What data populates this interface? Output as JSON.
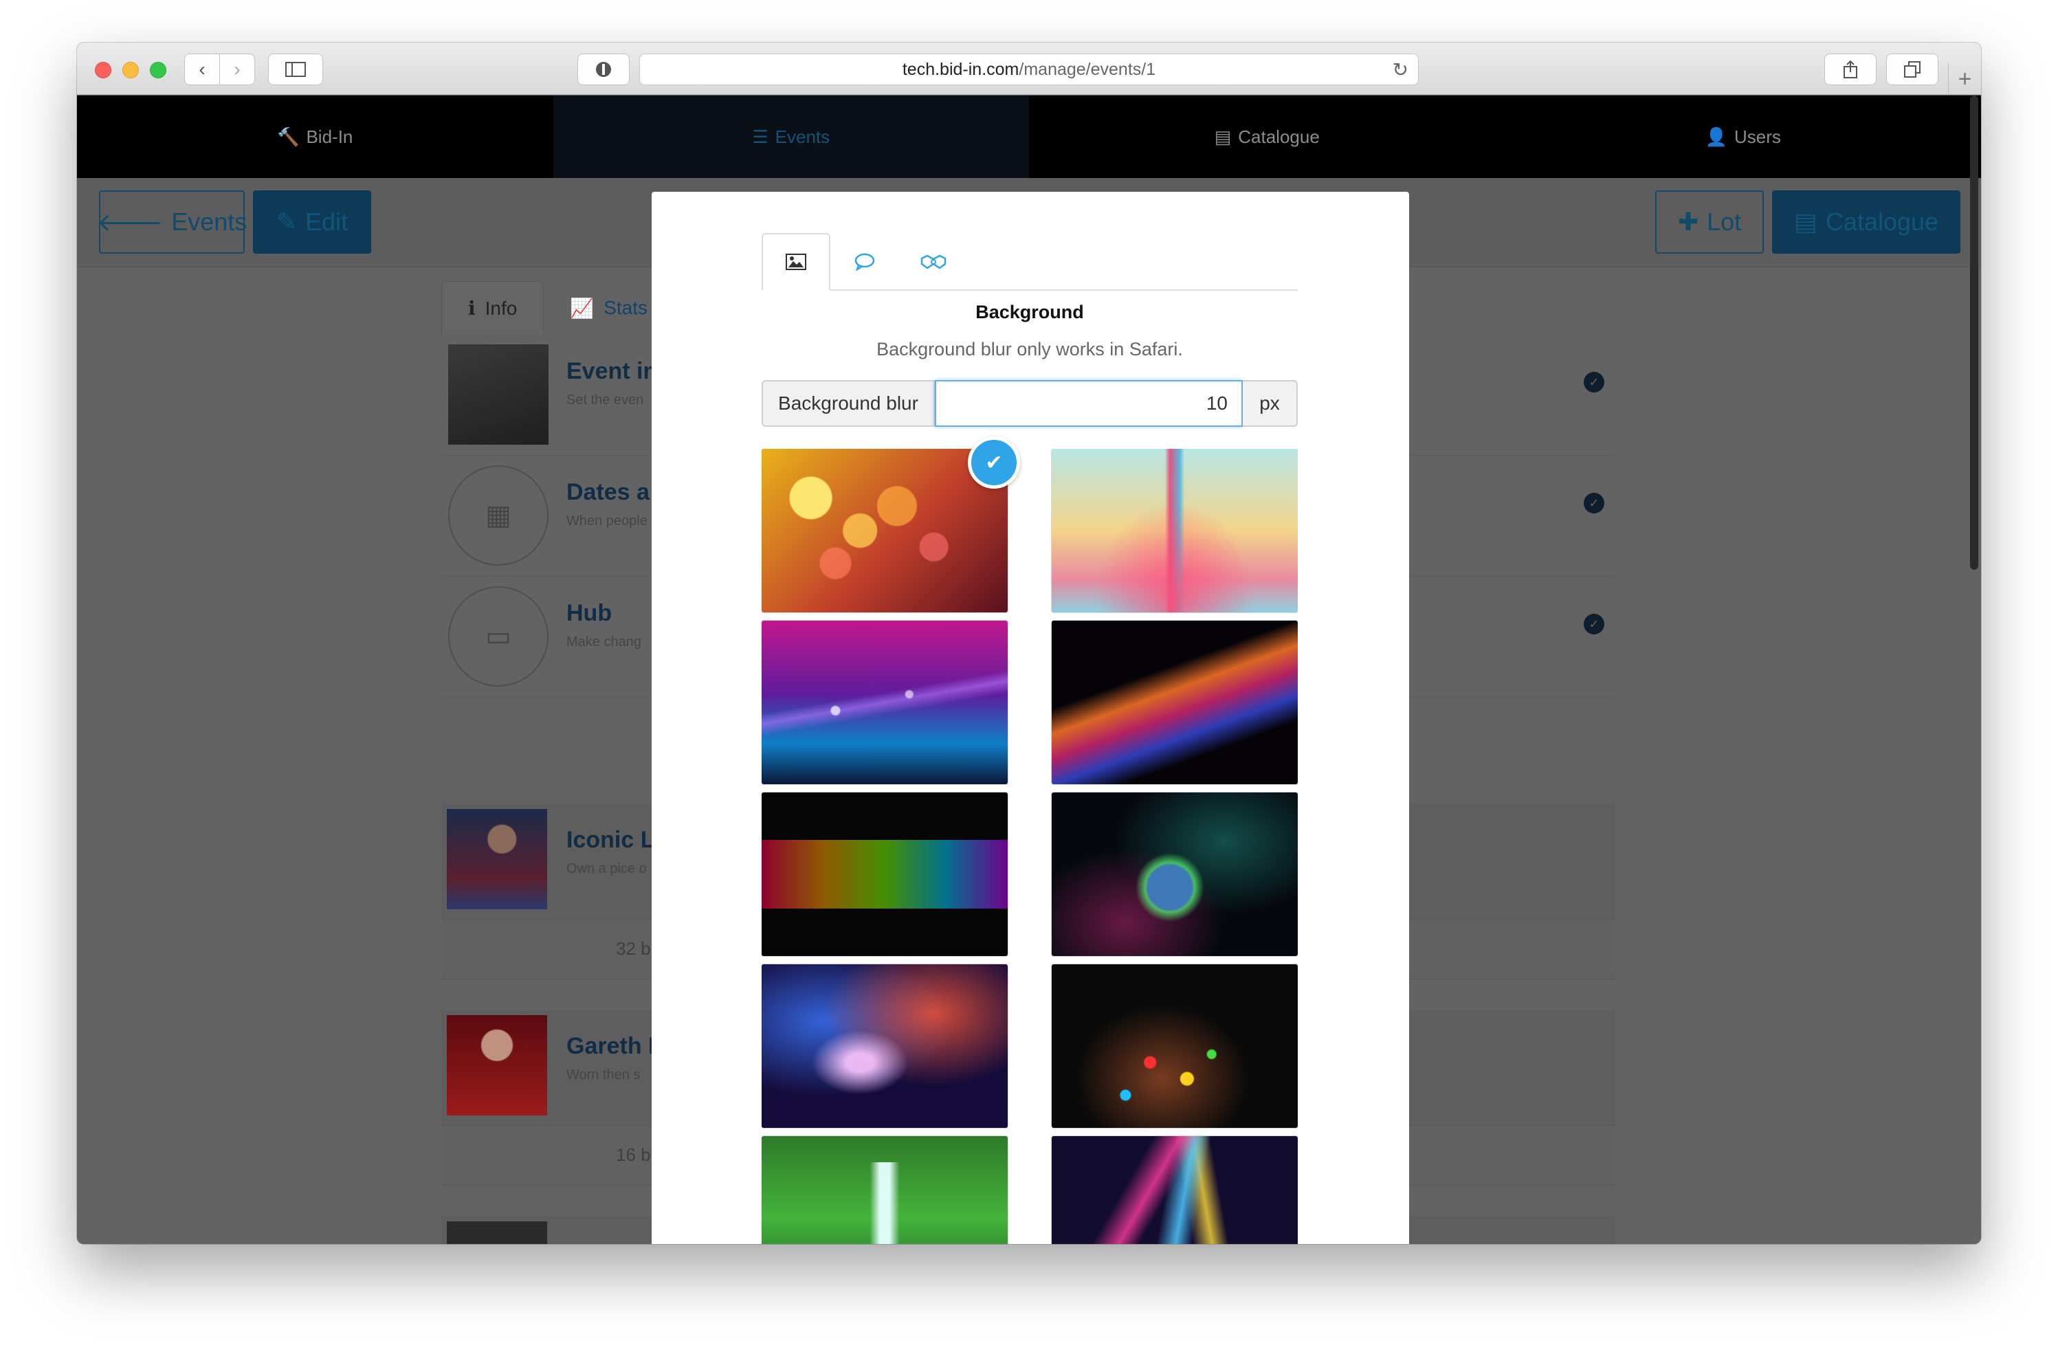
{
  "browser": {
    "url_host": "tech.bid-in.com",
    "url_path": "/manage/events/1"
  },
  "topnav": {
    "items": [
      {
        "icon": "gavel-icon",
        "label": "Bid-In"
      },
      {
        "icon": "list-icon",
        "label": "Events"
      },
      {
        "icon": "book-icon",
        "label": "Catalogue"
      },
      {
        "icon": "user-icon",
        "label": "Users"
      }
    ],
    "active": "Events"
  },
  "toolbar": {
    "events_label": "Events",
    "edit_label": "Edit",
    "lot_label": "Lot",
    "catalogue_label": "Catalogue"
  },
  "page_tabs": {
    "info_label": "Info",
    "stats_label": "Stats"
  },
  "event_rows": [
    {
      "title": "Event im",
      "subtitle": "Set the even"
    },
    {
      "title": "Dates a",
      "subtitle": "When people"
    },
    {
      "title": "Hub",
      "subtitle": "Make chang"
    }
  ],
  "lots": [
    {
      "title": "Iconic L",
      "subtitle": "Own a pice o",
      "bids": "32 b"
    },
    {
      "title": "Gareth B",
      "subtitle": "Worn then s",
      "bids": "16 b"
    }
  ],
  "modal": {
    "tabs": [
      {
        "icon": "image-icon",
        "active": true
      },
      {
        "icon": "speech-bubble-icon",
        "active": false
      },
      {
        "icon": "handshake-icon",
        "active": false
      }
    ],
    "heading": "Background",
    "note": "Background blur only works in Safari.",
    "blur_label": "Background blur",
    "blur_value": "10",
    "blur_unit": "px",
    "backgrounds": [
      {
        "name": "warm-bokeh",
        "selected": true
      },
      {
        "name": "paint-splash",
        "selected": false
      },
      {
        "name": "purple-wave",
        "selected": false
      },
      {
        "name": "color-smoke",
        "selected": false
      },
      {
        "name": "rainbow-bokeh",
        "selected": false
      },
      {
        "name": "glowing-planet",
        "selected": false
      },
      {
        "name": "nebula",
        "selected": false
      },
      {
        "name": "color-dots",
        "selected": false
      },
      {
        "name": "waterfall",
        "selected": false
      },
      {
        "name": "light-waves",
        "selected": false
      }
    ]
  },
  "colors": {
    "accent": "#2fa4e7",
    "nav_bg": "#000000",
    "overlay": "#636363"
  }
}
